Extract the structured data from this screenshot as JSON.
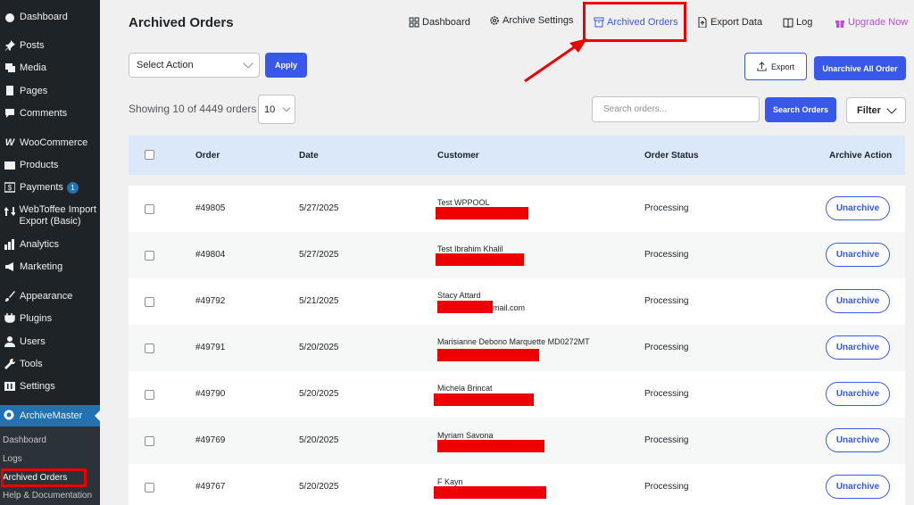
{
  "sidebar": {
    "items": [
      {
        "label": "Dashboard",
        "icon": "dashboard-icon"
      },
      {
        "label": "Posts",
        "icon": "pin-icon"
      },
      {
        "label": "Media",
        "icon": "media-icon"
      },
      {
        "label": "Pages",
        "icon": "pages-icon"
      },
      {
        "label": "Comments",
        "icon": "comment-icon"
      },
      {
        "label": "WooCommerce",
        "icon": "woo-icon"
      },
      {
        "label": "Products",
        "icon": "products-icon"
      },
      {
        "label": "Payments",
        "icon": "payments-icon",
        "badge": "1"
      },
      {
        "label": "WebToffee Import Export (Basic)",
        "icon": "import-export-icon"
      },
      {
        "label": "Analytics",
        "icon": "analytics-icon"
      },
      {
        "label": "Marketing",
        "icon": "marketing-icon"
      },
      {
        "label": "Appearance",
        "icon": "appearance-icon"
      },
      {
        "label": "Plugins",
        "icon": "plugins-icon"
      },
      {
        "label": "Users",
        "icon": "users-icon"
      },
      {
        "label": "Tools",
        "icon": "tools-icon"
      },
      {
        "label": "Settings",
        "icon": "settings-icon"
      }
    ],
    "active": {
      "label": "ArchiveMaster",
      "icon": "archive-master-icon"
    },
    "submenu": [
      "Dashboard",
      "Logs",
      "Archived Orders",
      "Help & Documentation"
    ],
    "submenu_current": "Archived Orders"
  },
  "header": {
    "title": "Archived Orders",
    "nav": [
      {
        "label": "Dashboard",
        "icon": "grid-icon"
      },
      {
        "label": "Archive Settings",
        "icon": "gear-icon"
      },
      {
        "label": "Archived Orders",
        "icon": "archive-box-icon",
        "active": true
      },
      {
        "label": "Export Data",
        "icon": "file-export-icon"
      },
      {
        "label": "Log",
        "icon": "book-icon"
      },
      {
        "label": "Upgrade Now",
        "icon": "gift-icon"
      }
    ]
  },
  "controls": {
    "bulk_action_value": "Select Action",
    "apply_label": "Apply",
    "export_label": "Export",
    "unarchive_all_label": "Unarchive All Order",
    "showing_text": "Showing 10 of 4449 orders",
    "per_page_value": "10",
    "search_placeholder": "Search orders...",
    "search_button_label": "Search Orders",
    "filter_label": "Filter"
  },
  "table": {
    "columns": [
      "Order",
      "Date",
      "Customer",
      "Order Status",
      "Archive Action"
    ],
    "rows": [
      {
        "order": "#49805",
        "date": "5/27/2025",
        "customer": "Test WPPOOL",
        "customer_line2": "",
        "status": "Processing",
        "action": "Unarchive"
      },
      {
        "order": "#49804",
        "date": "5/27/2025",
        "customer": "Test Ibrahim Khalil",
        "customer_line2": "",
        "status": "Processing",
        "action": "Unarchive"
      },
      {
        "order": "#49792",
        "date": "5/21/2025",
        "customer": "Stacy Attard",
        "customer_line2": "mail.com",
        "status": "Processing",
        "action": "Unarchive"
      },
      {
        "order": "#49791",
        "date": "5/20/2025",
        "customer": "Marisianne Debono Marquette MD0272MT",
        "customer_line2": "",
        "status": "Processing",
        "action": "Unarchive"
      },
      {
        "order": "#49790",
        "date": "5/20/2025",
        "customer": "Michela Brincat",
        "customer_line2": "",
        "status": "Processing",
        "action": "Unarchive"
      },
      {
        "order": "#49769",
        "date": "5/20/2025",
        "customer": "Myriam Savona",
        "customer_line2": "",
        "status": "Processing",
        "action": "Unarchive"
      },
      {
        "order": "#49767",
        "date": "5/20/2025",
        "customer": "F Kayn",
        "customer_line2": "",
        "status": "Processing",
        "action": "Unarchive"
      }
    ]
  },
  "colors": {
    "accent": "#3858e9",
    "annotation": "#ee0000",
    "upgrade": "#b84fd6",
    "sidebar_bg": "#1d2327",
    "header_row": "#dbe8f9"
  }
}
